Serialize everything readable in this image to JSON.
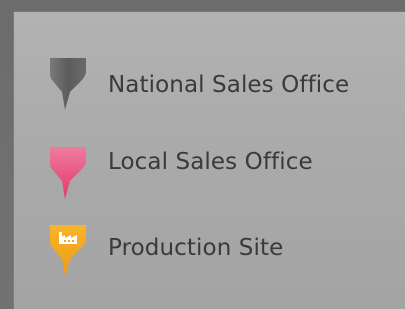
{
  "legend": {
    "items": [
      {
        "label": "National Sales Office",
        "icon": "national-sales-office-marker-icon",
        "color": "#5f5f5f"
      },
      {
        "label": "Local Sales Office",
        "icon": "local-sales-office-marker-icon",
        "color": "#e8457a"
      },
      {
        "label": "Production Site",
        "icon": "production-site-marker-icon",
        "color": "#f4a71a"
      }
    ]
  }
}
